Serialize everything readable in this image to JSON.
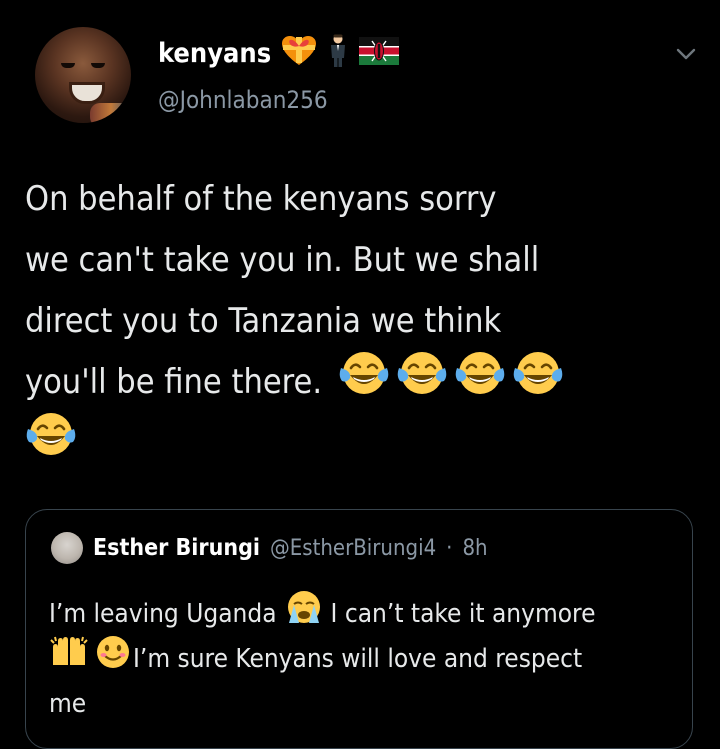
{
  "header": {
    "display_name": "kenyans",
    "handle": "@Johnlaban256"
  },
  "tweet": {
    "lines": [
      "On behalf of the kenyans sorry",
      "we can't take you in. But we shall",
      "direct you to Tanzania we think",
      "you'll be fine there."
    ],
    "emojis": [
      "joy-emoji",
      "joy-emoji",
      "joy-emoji",
      "joy-emoji",
      "joy-emoji"
    ]
  },
  "quoted": {
    "name": "Esther Birungi",
    "handle": "@EstherBirungi4",
    "separator": "·",
    "time": "8h",
    "line1_a": "I’m leaving Uganda",
    "line1_b": "I can’t take it anymore",
    "line2": "I’m sure Kenyans will love and respect",
    "line3": "me"
  },
  "colors": {
    "background": "#000000",
    "text": "#e7e9ea",
    "secondary": "#8b98a5",
    "border": "#38444d"
  }
}
